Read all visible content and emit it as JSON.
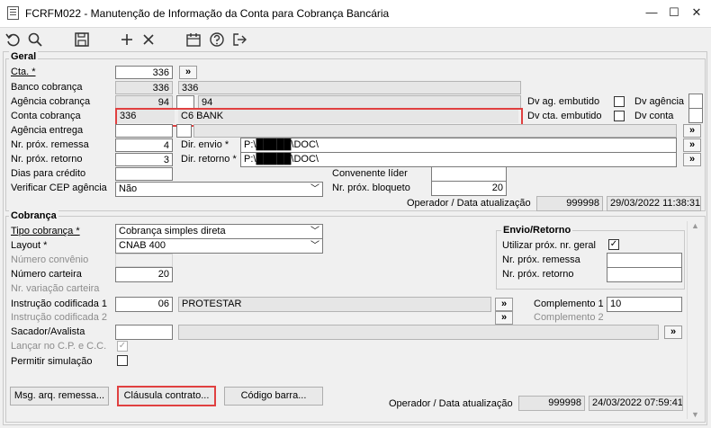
{
  "window": {
    "title": "FCRFM022 - Manutenção de Informação da Conta para Cobrança Bancária",
    "min": "—",
    "max": "☐",
    "close": "✕"
  },
  "colors": {
    "highlight": "#e04040",
    "readonly": "#e6e6e6"
  },
  "toolbar": {
    "icons": [
      "undo-icon",
      "search-icon",
      "save-icon",
      "add-icon",
      "delete-icon",
      "calendar-icon",
      "help-icon",
      "exit-icon"
    ]
  },
  "geral": {
    "title": "Geral",
    "cta_label": "Cta. *",
    "cta_value": "336",
    "cta_btn": "»",
    "banco_label": "Banco cobrança",
    "banco_code": "336",
    "banco_name": "336",
    "agencia_label": "Agência cobrança",
    "agencia_code": "94",
    "agencia_name": "94",
    "dv_ag_embutido": "Dv ag. embutido",
    "dv_agencia": "Dv agência",
    "conta_label": "Conta cobrança",
    "conta_code": "336",
    "conta_name": "C6 BANK",
    "dv_cta_embutido": "Dv cta. embutido",
    "dv_conta": "Dv conta",
    "agencia_entrega_label": "Agência entrega",
    "agencia_entrega_btn": "»",
    "nr_prox_remessa_label": "Nr. próx. remessa",
    "nr_prox_remessa": "4",
    "dir_envio_label": "Dir. envio *",
    "dir_envio": "P:\\█████\\DOC\\",
    "dir_envio_btn": "»",
    "nr_prox_retorno_label": "Nr. próx. retorno",
    "nr_prox_retorno": "3",
    "dir_retorno_label": "Dir. retorno *",
    "dir_retorno": "P:\\█████\\DOC\\",
    "dir_retorno_btn": "»",
    "dias_credito_label": "Dias para crédito",
    "dias_credito": "",
    "convenente_label": "Convenente líder",
    "convenente": "",
    "cep_label": "Verificar CEP agência",
    "cep_value": "Não",
    "nr_bloqueto_label": "Nr. próx. bloqueto",
    "nr_bloqueto": "20",
    "operador_label": "Operador / Data atualização",
    "operador": "999998",
    "data": "29/03/2022 11:38:31"
  },
  "cobranca": {
    "title": "Cobrança",
    "tipo_label": "Tipo cobrança *",
    "tipo_value": "Cobrança simples direta",
    "layout_label": "Layout *",
    "layout_value": "CNAB 400",
    "numero_convenio_label": "Número convênio",
    "numero_carteira_label": "Número carteira",
    "numero_carteira": "20",
    "nr_variacao_label": "Nr. variação carteira",
    "instr1_label": "Instrução codificada 1",
    "instr1_code": "06",
    "instr1_desc": "PROTESTAR",
    "instr1_btn": "»",
    "instr2_label": "Instrução codificada 2",
    "instr2_btn": "»",
    "complemento1_label": "Complemento 1",
    "complemento1": "10",
    "complemento2_label": "Complemento 2",
    "sacador_label": "Sacador/Avalista",
    "sacador_btn": "»",
    "lancar_label": "Lançar no C.P. e C.C.",
    "permitir_label": "Permitir simulação",
    "envio_retorno": {
      "title": "Envio/Retorno",
      "utilizar_label": "Utilizar próx. nr. geral",
      "remessa_label": "Nr. próx. remessa",
      "retorno_label": "Nr. próx. retorno"
    }
  },
  "footer": {
    "msg_btn": "Msg. arq. remessa...",
    "clausula_btn": "Cláusula contrato...",
    "codigo_btn": "Código barra...",
    "operador_label": "Operador / Data atualização",
    "operador": "999998",
    "data": "24/03/2022 07:59:41"
  }
}
